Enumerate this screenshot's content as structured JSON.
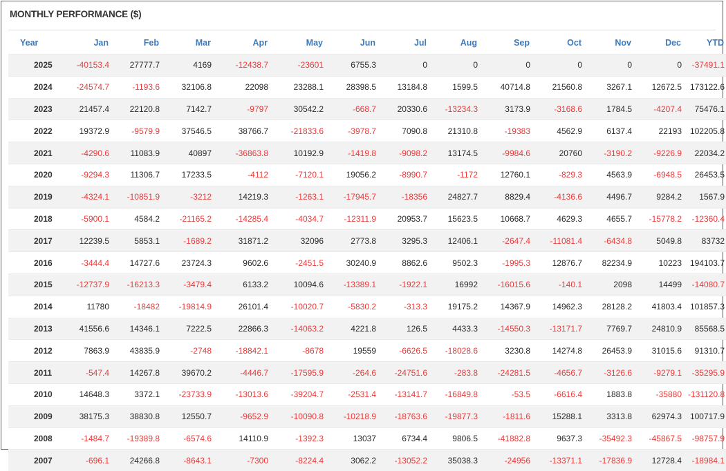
{
  "title": "MONTHLY PERFORMANCE ($)",
  "colors": {
    "header_text": "#3b7bbf",
    "negative": "#ea3a3a",
    "stripe": "#f2f2f2"
  },
  "headers": [
    "Year",
    "Jan",
    "Feb",
    "Mar",
    "Apr",
    "May",
    "Jun",
    "Jul",
    "Aug",
    "Sep",
    "Oct",
    "Nov",
    "Dec",
    "YTD"
  ],
  "rows": [
    [
      "2025",
      "-40153.4",
      "27777.7",
      "4169",
      "-12438.7",
      "-23601",
      "6755.3",
      "0",
      "0",
      "0",
      "0",
      "0",
      "0",
      "-37491.1"
    ],
    [
      "2024",
      "-24574.7",
      "-1193.6",
      "32106.8",
      "22098",
      "23288.1",
      "28398.5",
      "13184.8",
      "1599.5",
      "40714.8",
      "21560.8",
      "3267.1",
      "12672.5",
      "173122.6"
    ],
    [
      "2023",
      "21457.4",
      "22120.8",
      "7142.7",
      "-9797",
      "30542.2",
      "-668.7",
      "20330.6",
      "-13234.3",
      "3173.9",
      "-3168.6",
      "1784.5",
      "-4207.4",
      "75476.1"
    ],
    [
      "2022",
      "19372.9",
      "-9579.9",
      "37546.5",
      "38766.7",
      "-21833.6",
      "-3978.7",
      "7090.8",
      "21310.8",
      "-19383",
      "4562.9",
      "6137.4",
      "22193",
      "102205.8"
    ],
    [
      "2021",
      "-4290.6",
      "11083.9",
      "40897",
      "-36863.8",
      "10192.9",
      "-1419.8",
      "-9098.2",
      "13174.5",
      "-9984.6",
      "20760",
      "-3190.2",
      "-9226.9",
      "22034.2"
    ],
    [
      "2020",
      "-9294.3",
      "11306.7",
      "17233.5",
      "-4112",
      "-7120.1",
      "19056.2",
      "-8990.7",
      "-1172",
      "12760.1",
      "-829.3",
      "4563.9",
      "-6948.5",
      "26453.5"
    ],
    [
      "2019",
      "-4324.1",
      "-10851.9",
      "-3212",
      "14219.3",
      "-1263.1",
      "-17945.7",
      "-18356",
      "24827.7",
      "8829.4",
      "-4136.6",
      "4496.7",
      "9284.2",
      "1567.9"
    ],
    [
      "2018",
      "-5900.1",
      "4584.2",
      "-21165.2",
      "-14285.4",
      "-4034.7",
      "-12311.9",
      "20953.7",
      "15623.5",
      "10668.7",
      "4629.3",
      "4655.7",
      "-15778.2",
      "-12360.4"
    ],
    [
      "2017",
      "12239.5",
      "5853.1",
      "-1689.2",
      "31871.2",
      "32096",
      "2773.8",
      "3295.3",
      "12406.1",
      "-2647.4",
      "-11081.4",
      "-6434.8",
      "5049.8",
      "83732"
    ],
    [
      "2016",
      "-3444.4",
      "14727.6",
      "23724.3",
      "9602.6",
      "-2451.5",
      "30240.9",
      "8862.6",
      "9502.3",
      "-1995.3",
      "12876.7",
      "82234.9",
      "10223",
      "194103.7"
    ],
    [
      "2015",
      "-12737.9",
      "-16213.3",
      "-3479.4",
      "6133.2",
      "10094.6",
      "-13389.1",
      "-1922.1",
      "16992",
      "-16015.6",
      "-140.1",
      "2098",
      "14499",
      "-14080.7"
    ],
    [
      "2014",
      "11780",
      "-18482",
      "-19814.9",
      "26101.4",
      "-10020.7",
      "-5830.2",
      "-313.3",
      "19175.2",
      "14367.9",
      "14962.3",
      "28128.2",
      "41803.4",
      "101857.3"
    ],
    [
      "2013",
      "41556.6",
      "14346.1",
      "7222.5",
      "22866.3",
      "-14063.2",
      "4221.8",
      "126.5",
      "4433.3",
      "-14550.3",
      "-13171.7",
      "7769.7",
      "24810.9",
      "85568.5"
    ],
    [
      "2012",
      "7863.9",
      "43835.9",
      "-2748",
      "-18842.1",
      "-8678",
      "19559",
      "-6626.5",
      "-18028.6",
      "3230.8",
      "14274.8",
      "26453.9",
      "31015.6",
      "91310.7"
    ],
    [
      "2011",
      "-547.4",
      "14267.8",
      "39670.2",
      "-4446.7",
      "-17595.9",
      "-264.6",
      "-24751.6",
      "-283.8",
      "-24281.5",
      "-4656.7",
      "-3126.6",
      "-9279.1",
      "-35295.9"
    ],
    [
      "2010",
      "14648.3",
      "3372.1",
      "-23733.9",
      "-13013.6",
      "-39204.7",
      "-2531.4",
      "-13141.7",
      "-16849.8",
      "-53.5",
      "-6616.4",
      "1883.8",
      "-35880",
      "-131120.8"
    ],
    [
      "2009",
      "38175.3",
      "38830.8",
      "12550.7",
      "-9652.9",
      "-10090.8",
      "-10218.9",
      "-18763.6",
      "-19877.3",
      "-1811.6",
      "15288.1",
      "3313.8",
      "62974.3",
      "100717.9"
    ],
    [
      "2008",
      "-1484.7",
      "-19389.8",
      "-6574.6",
      "14110.9",
      "-1392.3",
      "13037",
      "6734.4",
      "9806.5",
      "-41882.8",
      "9637.3",
      "-35492.3",
      "-45867.5",
      "-98757.9"
    ],
    [
      "2007",
      "-696.1",
      "24266.8",
      "-8643.1",
      "-7300",
      "-8224.4",
      "3062.2",
      "-13052.2",
      "35038.3",
      "-24956",
      "-13371.1",
      "-17836.9",
      "12728.4",
      "-18984.1"
    ]
  ]
}
